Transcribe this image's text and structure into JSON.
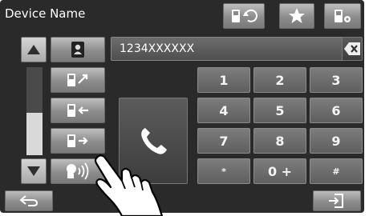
{
  "header": {
    "title": "Device Name"
  },
  "number_field": {
    "value": "1234XXXXXX"
  },
  "keypad": {
    "keys": [
      "1",
      "2",
      "3",
      "4",
      "5",
      "6",
      "7",
      "8",
      "9",
      "*",
      "0 +",
      "#"
    ]
  },
  "icons": {
    "reconnect": "phone-refresh-icon",
    "favorites": "star-icon",
    "settings": "phone-settings-icon",
    "scroll_up": "triangle-up-icon",
    "scroll_down": "triangle-down-icon",
    "phonebook": "phonebook-icon",
    "outgoing": "outgoing-call-icon",
    "incoming": "incoming-call-icon",
    "missed": "missed-call-icon",
    "voice": "voice-dial-icon",
    "call": "phone-handset-icon",
    "backspace": "backspace-icon",
    "back": "back-arrow-icon",
    "exit": "exit-icon"
  },
  "colors": {
    "screen": "#2a2a2a",
    "button": "#9a9a9a",
    "key": "#6a6a6a",
    "text": "#ffffff"
  }
}
